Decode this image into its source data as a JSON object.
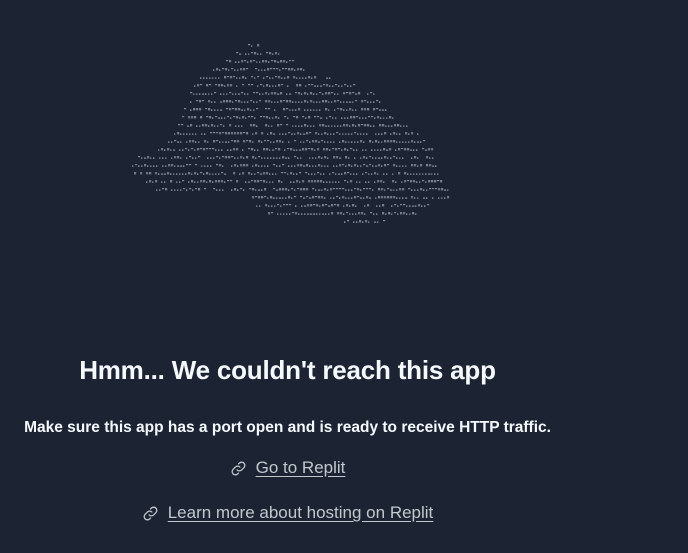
{
  "error": {
    "title": "Hmm... We couldn't reach this app",
    "message": "Make sure this app has a port open and is ready to receive HTTP traffic."
  },
  "links": [
    {
      "label": "Go to Replit",
      "icon": "link-icon"
    },
    {
      "label": "Learn more about hosting on Replit",
      "icon": "link-icon"
    }
  ],
  "colors": {
    "background": "#1c2333",
    "text": "#f5f9fc",
    "link": "#c2c8cc",
    "ascii_art": "#9aa3ad"
  }
}
